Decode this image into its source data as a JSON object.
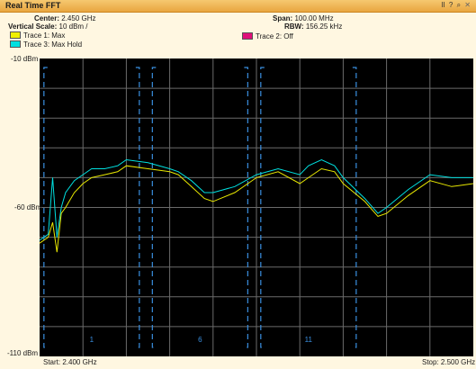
{
  "window": {
    "title": "Real Time FFT",
    "buttons": [
      "II",
      "?",
      "⌕",
      "✕"
    ]
  },
  "info": {
    "center_label": "Center:",
    "center_value": "2.450 GHz",
    "vscale_label": "Vertical Scale:",
    "vscale_value": "10 dBm /",
    "span_label": "Span:",
    "span_value": "100.00 MHz",
    "rbw_label": "RBW:",
    "rbw_value": "156.25 kHz"
  },
  "legend": [
    {
      "label": "Trace 1: Max",
      "color": "#f0f000"
    },
    {
      "label": "Trace 3: Max Hold",
      "color": "#00e0e0"
    },
    {
      "label": "Trace 2: Off",
      "color": "#e0107a"
    }
  ],
  "axes": {
    "y_top_label": "-10 dBm",
    "y_mid_label": "-60 dBm",
    "y_bottom_label": "-110 dBm",
    "start_label": "Start: 2.400 GHz",
    "stop_label": "Stop: 2.500 GHz"
  },
  "channels": [
    {
      "label": "1",
      "start_ghz": 2.401,
      "end_ghz": 2.423
    },
    {
      "label": "6",
      "start_ghz": 2.426,
      "end_ghz": 2.448
    },
    {
      "label": "11",
      "start_ghz": 2.451,
      "end_ghz": 2.473
    }
  ],
  "chart_data": {
    "type": "line",
    "xlim": [
      2.4,
      2.5
    ],
    "ylim": [
      -110,
      -10
    ],
    "grid": true,
    "series": [
      {
        "name": "Trace 1: Max",
        "color": "#e8e800",
        "x": [
          2.4,
          2.402,
          2.403,
          2.404,
          2.405,
          2.406,
          2.408,
          2.41,
          2.412,
          2.415,
          2.418,
          2.42,
          2.425,
          2.43,
          2.432,
          2.435,
          2.438,
          2.44,
          2.445,
          2.45,
          2.455,
          2.46,
          2.462,
          2.465,
          2.468,
          2.47,
          2.475,
          2.478,
          2.48,
          2.485,
          2.49,
          2.495,
          2.5
        ],
        "y": [
          -72,
          -70,
          -65,
          -75,
          -62,
          -60,
          -55,
          -52,
          -50,
          -49,
          -48,
          -46,
          -47,
          -48,
          -49,
          -53,
          -57,
          -58,
          -55,
          -50,
          -48,
          -52,
          -50,
          -47,
          -48,
          -52,
          -58,
          -63,
          -62,
          -56,
          -51,
          -53,
          -52
        ]
      },
      {
        "name": "Trace 3: Max Hold",
        "color": "#00e0e0",
        "x": [
          2.4,
          2.402,
          2.403,
          2.404,
          2.405,
          2.406,
          2.408,
          2.41,
          2.412,
          2.415,
          2.418,
          2.42,
          2.425,
          2.43,
          2.432,
          2.435,
          2.438,
          2.44,
          2.445,
          2.45,
          2.455,
          2.46,
          2.462,
          2.465,
          2.468,
          2.47,
          2.475,
          2.478,
          2.48,
          2.485,
          2.49,
          2.495,
          2.5
        ],
        "y": [
          -71,
          -69,
          -50,
          -70,
          -60,
          -55,
          -51,
          -49,
          -47,
          -47,
          -46,
          -44,
          -45,
          -47,
          -48,
          -51,
          -55,
          -55,
          -53,
          -49,
          -47,
          -49,
          -46,
          -44,
          -46,
          -50,
          -57,
          -62,
          -60,
          -54,
          -49,
          -50,
          -50
        ]
      }
    ]
  }
}
